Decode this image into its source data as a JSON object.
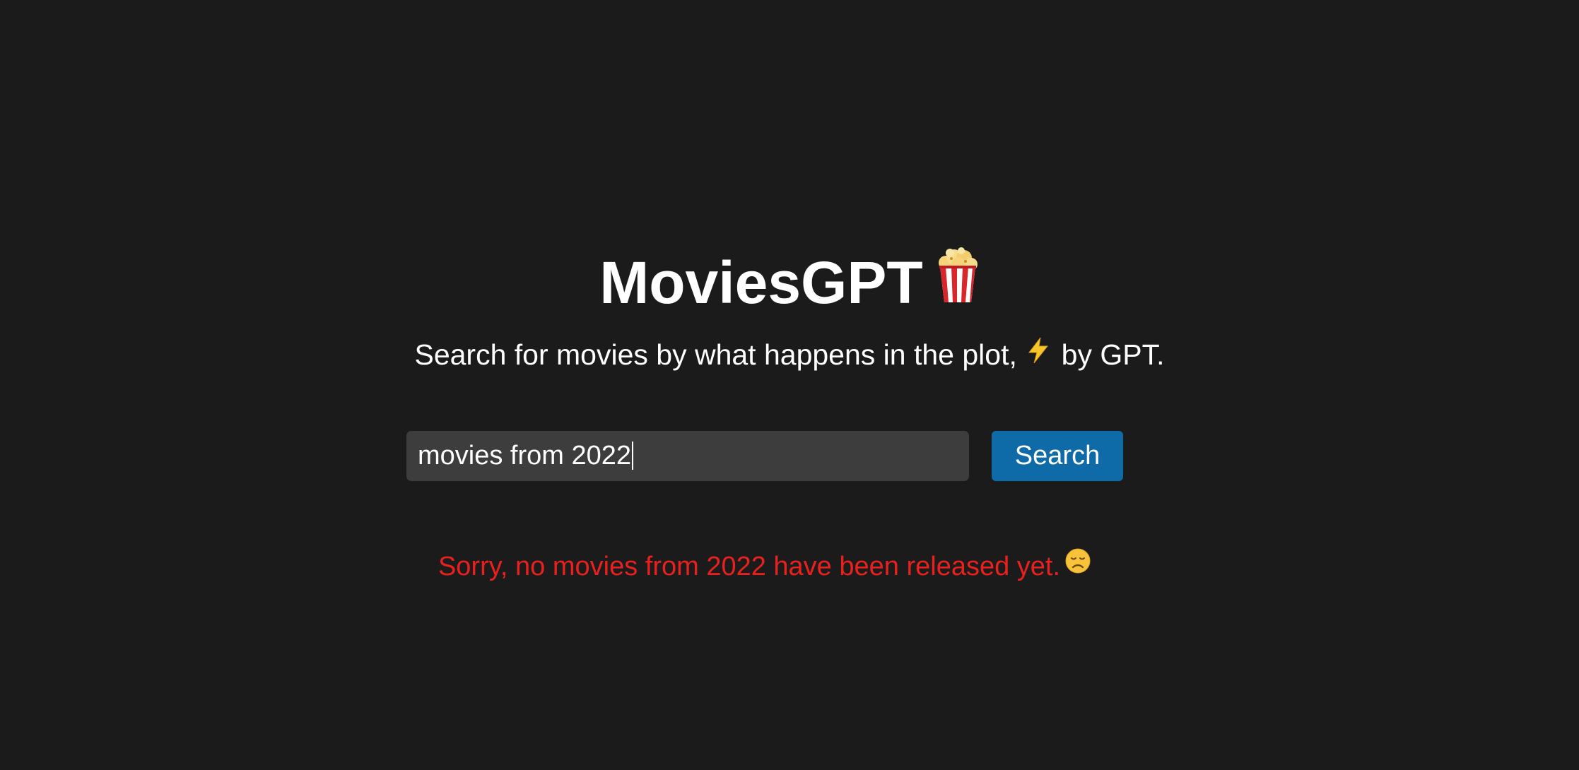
{
  "app": {
    "title": "MoviesGPT",
    "title_icon": "popcorn-icon",
    "subtitle_before": "Search for movies by what happens in the plot,",
    "subtitle_icon": "lightning-bolt-icon",
    "subtitle_after": "by GPT."
  },
  "search": {
    "value": "movies from 2022",
    "button_label": "Search"
  },
  "result": {
    "message": "Sorry, no movies from 2022 have been released yet.",
    "message_icon": "sad-face-icon"
  },
  "colors": {
    "background": "#1b1b1b",
    "input_background": "#3d3d3d",
    "button": "#0f6aa8",
    "error": "#e8211f",
    "text": "#ffffff"
  }
}
